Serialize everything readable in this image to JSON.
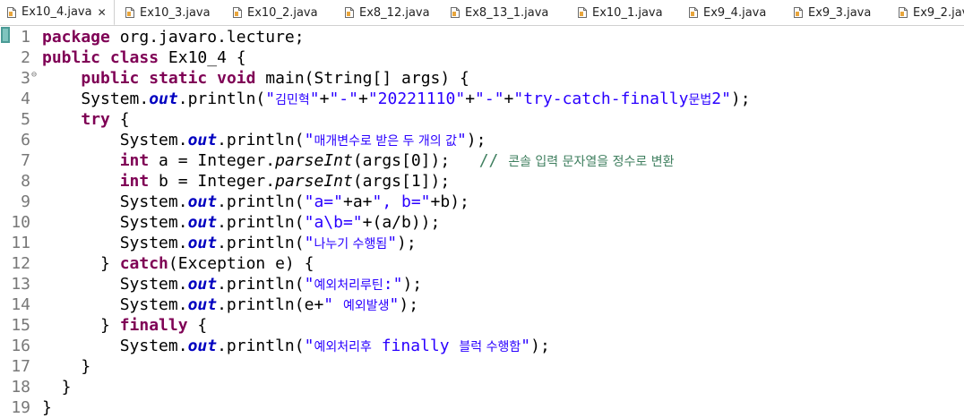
{
  "tabs": [
    {
      "label": "Ex10_4.java",
      "close": "✕",
      "active": true
    },
    {
      "label": "Ex10_3.java"
    },
    {
      "label": "Ex10_2.java"
    },
    {
      "label": "Ex8_12.java"
    },
    {
      "label": "Ex8_13_1.java"
    },
    {
      "label": "Ex10_1.java"
    },
    {
      "label": "Ex9_4.java"
    },
    {
      "label": "Ex9_3.java"
    },
    {
      "label": "Ex9_2.java"
    }
  ],
  "editor": {
    "fold_marker": "⊖",
    "lines": [
      {
        "num": "1",
        "segments": [
          [
            "kw",
            "package"
          ],
          [
            "t",
            " org.javaro.lecture;"
          ]
        ]
      },
      {
        "num": "2",
        "segments": [
          [
            "kw",
            "public"
          ],
          [
            "t",
            " "
          ],
          [
            "kw",
            "class"
          ],
          [
            "t",
            " Ex10_4 {"
          ]
        ]
      },
      {
        "num": "3",
        "segments": [
          [
            "t",
            "    "
          ],
          [
            "kw",
            "public"
          ],
          [
            "t",
            " "
          ],
          [
            "kw",
            "static"
          ],
          [
            "t",
            " "
          ],
          [
            "kw",
            "void"
          ],
          [
            "t",
            " main(String[] args) {"
          ]
        ]
      },
      {
        "num": "4",
        "segments": [
          [
            "t",
            "    System."
          ],
          [
            "field",
            "out"
          ],
          [
            "t",
            ".println("
          ],
          [
            "str",
            "\""
          ],
          [
            "strkr",
            "김민혁"
          ],
          [
            "str",
            "\""
          ],
          [
            "t",
            "+"
          ],
          [
            "str",
            "\"-\""
          ],
          [
            "t",
            "+"
          ],
          [
            "str",
            "\"20221110\""
          ],
          [
            "t",
            "+"
          ],
          [
            "str",
            "\"-\""
          ],
          [
            "t",
            "+"
          ],
          [
            "str",
            "\"try-catch-finally"
          ],
          [
            "strkr",
            "문법"
          ],
          [
            "str",
            "2\""
          ],
          [
            "t",
            ");"
          ]
        ]
      },
      {
        "num": "5",
        "segments": [
          [
            "t",
            "    "
          ],
          [
            "kw",
            "try"
          ],
          [
            "t",
            " {"
          ]
        ]
      },
      {
        "num": "6",
        "segments": [
          [
            "t",
            "        System."
          ],
          [
            "field",
            "out"
          ],
          [
            "t",
            ".println("
          ],
          [
            "str",
            "\""
          ],
          [
            "strkr",
            "매개변수로 받은 두 개의 값"
          ],
          [
            "str",
            "\""
          ],
          [
            "t",
            ");"
          ]
        ]
      },
      {
        "num": "7",
        "segments": [
          [
            "t",
            "        "
          ],
          [
            "kw",
            "int"
          ],
          [
            "t",
            " a = Integer."
          ],
          [
            "mi",
            "parseInt"
          ],
          [
            "t",
            "(args[0]);   "
          ],
          [
            "cm",
            "// "
          ],
          [
            "cmkr",
            "콘솔 입력 문자열을 정수로 변환"
          ]
        ]
      },
      {
        "num": "8",
        "segments": [
          [
            "t",
            "        "
          ],
          [
            "kw",
            "int"
          ],
          [
            "t",
            " b = Integer."
          ],
          [
            "mi",
            "parseInt"
          ],
          [
            "t",
            "(args[1]);"
          ]
        ]
      },
      {
        "num": "9",
        "segments": [
          [
            "t",
            "        System."
          ],
          [
            "field",
            "out"
          ],
          [
            "t",
            ".println("
          ],
          [
            "str",
            "\"a=\""
          ],
          [
            "t",
            "+a+"
          ],
          [
            "str",
            "\", b=\""
          ],
          [
            "t",
            "+b);"
          ]
        ]
      },
      {
        "num": "10",
        "segments": [
          [
            "t",
            "        System."
          ],
          [
            "field",
            "out"
          ],
          [
            "t",
            ".println("
          ],
          [
            "str",
            "\"a\\b=\""
          ],
          [
            "t",
            "+(a/b));"
          ]
        ]
      },
      {
        "num": "11",
        "segments": [
          [
            "t",
            "        System."
          ],
          [
            "field",
            "out"
          ],
          [
            "t",
            ".println("
          ],
          [
            "str",
            "\""
          ],
          [
            "strkr",
            "나누기 수행됨"
          ],
          [
            "str",
            "\""
          ],
          [
            "t",
            ");"
          ]
        ]
      },
      {
        "num": "12",
        "segments": [
          [
            "t",
            "      } "
          ],
          [
            "kw",
            "catch"
          ],
          [
            "t",
            "(Exception e) {"
          ]
        ]
      },
      {
        "num": "13",
        "segments": [
          [
            "t",
            "        System."
          ],
          [
            "field",
            "out"
          ],
          [
            "t",
            ".println("
          ],
          [
            "str",
            "\""
          ],
          [
            "strkr",
            "예외처리루틴"
          ],
          [
            "str",
            ":\""
          ],
          [
            "t",
            ");"
          ]
        ]
      },
      {
        "num": "14",
        "segments": [
          [
            "t",
            "        System."
          ],
          [
            "field",
            "out"
          ],
          [
            "t",
            ".println(e+"
          ],
          [
            "str",
            "\" "
          ],
          [
            "strkr",
            "예외발생"
          ],
          [
            "str",
            "\""
          ],
          [
            "t",
            ");"
          ]
        ]
      },
      {
        "num": "15",
        "segments": [
          [
            "t",
            "      } "
          ],
          [
            "kw",
            "finally"
          ],
          [
            "t",
            " {"
          ]
        ]
      },
      {
        "num": "16",
        "segments": [
          [
            "t",
            "        System."
          ],
          [
            "field",
            "out"
          ],
          [
            "t",
            ".println("
          ],
          [
            "str",
            "\""
          ],
          [
            "strkr",
            "예외처리후"
          ],
          [
            "str",
            " finally "
          ],
          [
            "strkr",
            "블럭 수행함"
          ],
          [
            "str",
            "\""
          ],
          [
            "t",
            ");"
          ]
        ]
      },
      {
        "num": "17",
        "segments": [
          [
            "t",
            "    }"
          ]
        ]
      },
      {
        "num": "18",
        "segments": [
          [
            "t",
            "  }"
          ]
        ]
      },
      {
        "num": "19",
        "segments": [
          [
            "t",
            "}"
          ]
        ]
      }
    ]
  },
  "colors": {
    "keyword": "#7f0055",
    "string": "#2a00ff",
    "field": "#0000c0",
    "comment": "#3f7f5f",
    "line_number": "#787878",
    "gutter_marker": "#4b9b96"
  }
}
